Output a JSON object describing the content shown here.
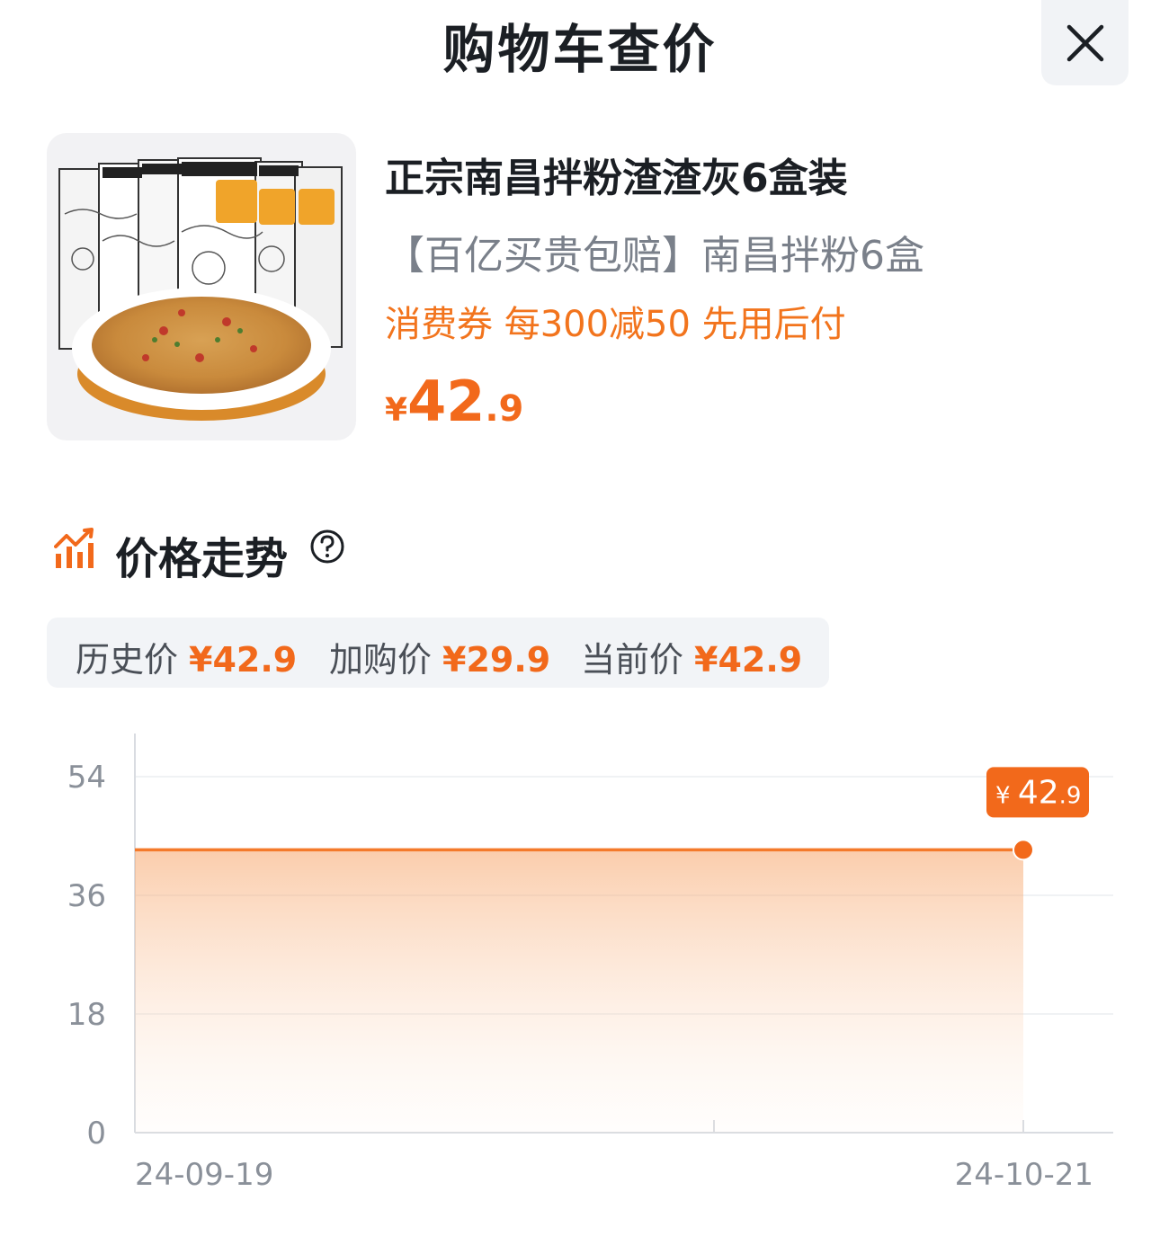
{
  "header": {
    "title": "购物车查价",
    "close_icon": "close-icon"
  },
  "product": {
    "image_icon": "product-photo",
    "name": "正宗南昌拌粉渣渣灰6盒装",
    "subtitle": "【百亿买贵包赔】南昌拌粉6盒",
    "promo": "消费券 每300减50 先用后付",
    "price": {
      "symbol": "¥",
      "integer": "42",
      "decimal": ".9"
    }
  },
  "trend": {
    "title": "价格走势",
    "icon": "bar-chart-icon",
    "help_icon": "help-icon"
  },
  "summary": [
    {
      "label": "历史价",
      "value": "¥42.9"
    },
    {
      "label": "加购价",
      "value": "¥29.9"
    },
    {
      "label": "当前价",
      "value": "¥42.9"
    }
  ],
  "colors": {
    "accent": "#f2691b",
    "accent_line": "#f47a2b",
    "text_primary": "#1b1f24",
    "text_secondary": "#7a808a"
  },
  "chart_data": {
    "type": "area",
    "x": [
      "24-09-19",
      "24-10-21"
    ],
    "values": [
      42.9,
      42.9
    ],
    "ylim": [
      0,
      54
    ],
    "yticks": [
      0,
      18,
      36,
      54
    ],
    "xtick_labels": [
      "24-09-19",
      "24-10-21"
    ],
    "grid": true,
    "annotation": {
      "symbol": "¥",
      "integer": "42",
      "decimal": ".9"
    }
  }
}
